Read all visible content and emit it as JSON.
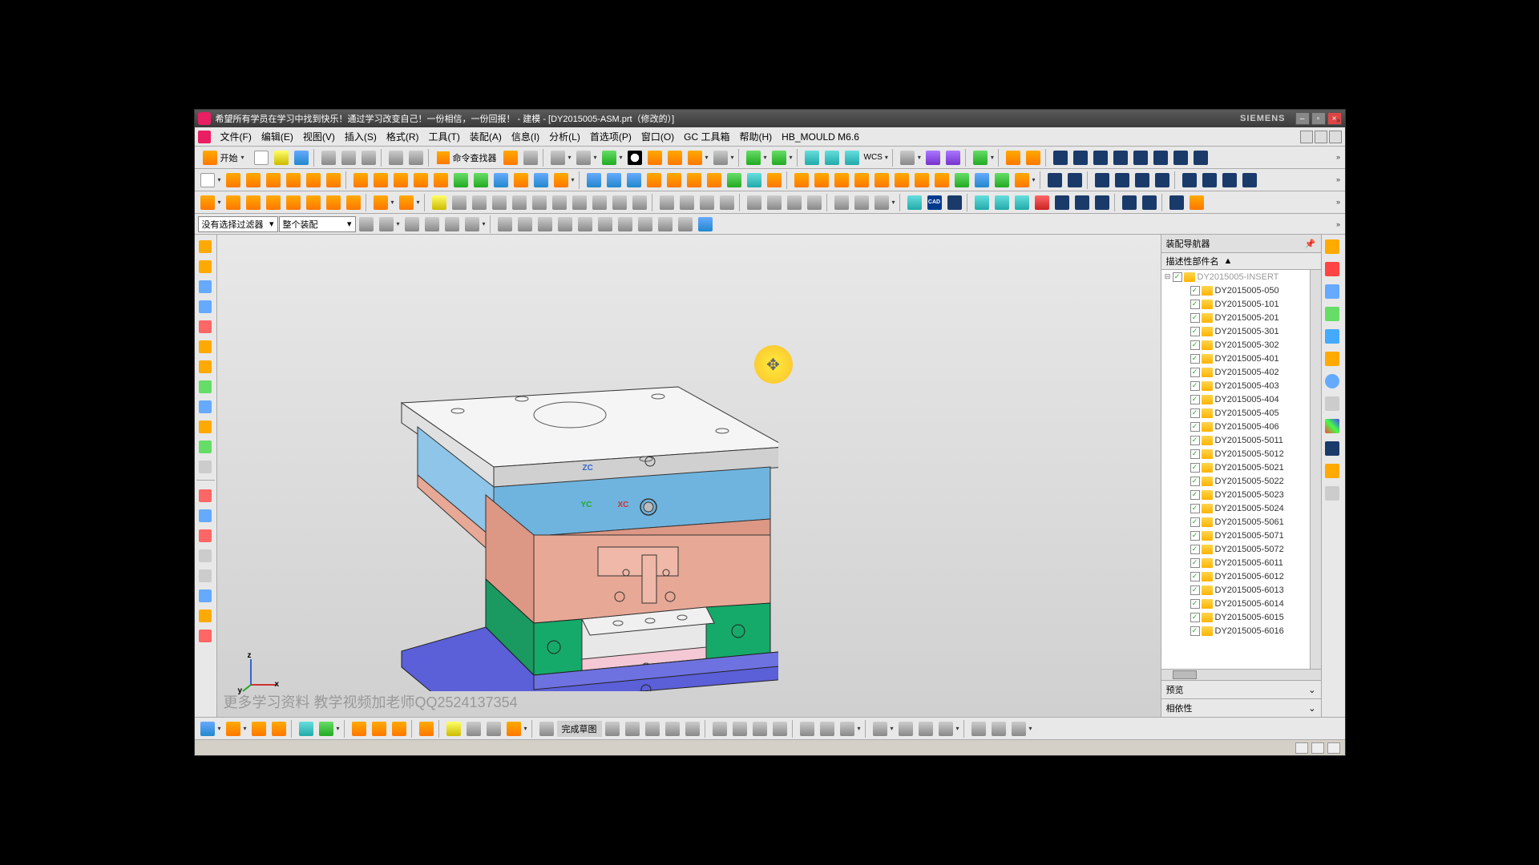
{
  "title_bar": {
    "text": "希望所有学员在学习中找到快乐！通过学习改变自己！一份相信，一份回报！ - 建模 - [DY2015005-ASM.prt（修改的）]",
    "brand": "SIEMENS"
  },
  "menu": {
    "items": [
      "文件(F)",
      "编辑(E)",
      "视图(V)",
      "插入(S)",
      "格式(R)",
      "工具(T)",
      "装配(A)",
      "信息(I)",
      "分析(L)",
      "首选项(P)",
      "窗口(O)",
      "GC 工具箱",
      "帮助(H)",
      "HB_MOULD M6.6"
    ]
  },
  "toolbar1": {
    "start_label": "开始",
    "cmd_finder_label": "命令查找器"
  },
  "filter_row": {
    "filter1": "没有选择过滤器",
    "filter2": "整个装配"
  },
  "viewport": {
    "zc": "ZC",
    "yc": "YC",
    "xc": "XC",
    "watermark": "更多学习资料 教学视频加老师QQ2524137354",
    "axis_x": "x",
    "axis_y": "y",
    "axis_z": "z"
  },
  "assembly_nav": {
    "title": "装配导航器",
    "column_header": "描述性部件名",
    "root": "DY2015005-INSERT",
    "items": [
      "DY2015005-050",
      "DY2015005-101",
      "DY2015005-201",
      "DY2015005-301",
      "DY2015005-302",
      "DY2015005-401",
      "DY2015005-402",
      "DY2015005-403",
      "DY2015005-404",
      "DY2015005-405",
      "DY2015005-406",
      "DY2015005-5011",
      "DY2015005-5012",
      "DY2015005-5021",
      "DY2015005-5022",
      "DY2015005-5023",
      "DY2015005-5024",
      "DY2015005-5061",
      "DY2015005-5071",
      "DY2015005-5072",
      "DY2015005-6011",
      "DY2015005-6012",
      "DY2015005-6013",
      "DY2015005-6014",
      "DY2015005-6015",
      "DY2015005-6016"
    ],
    "preview_label": "预览",
    "dependency_label": "相依性"
  },
  "bottom_bar": {
    "sketch_done": "完成草图"
  },
  "icons": {
    "cad_text": "CAD"
  }
}
